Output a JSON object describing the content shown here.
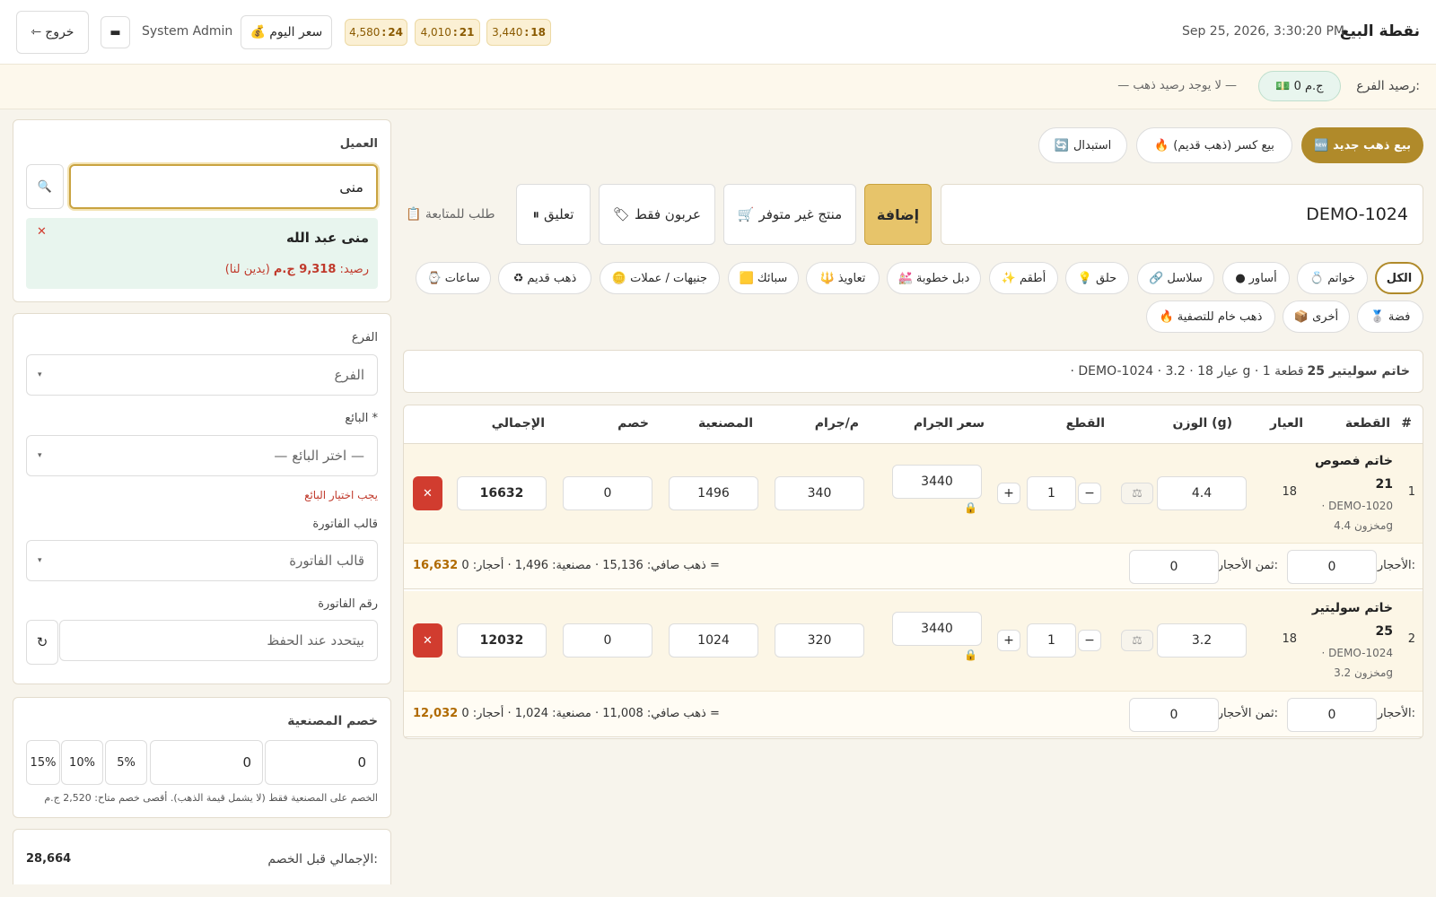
{
  "header": {
    "brand": "نقطة البيع",
    "datetime": "Sep 25, 2026, 3:30:20 PM",
    "logout_label": "خروج",
    "minimize_label": "▬",
    "user": "System Admin",
    "today_price_label": "سعر اليوم",
    "karats": [
      {
        "k": "18",
        "price": "3,440"
      },
      {
        "k": "21",
        "price": "4,010"
      },
      {
        "k": "24",
        "price": "4,580"
      }
    ]
  },
  "balance": {
    "label": "رصيد الفرع:",
    "value": "0 ج.م",
    "no_gold": "— لا يوجد رصيد ذهب —"
  },
  "modes": {
    "sell_new": "بيع ذهب جديد",
    "sell_scrap": "بيع كسر (ذهب قديم)",
    "exchange": "استبدال"
  },
  "entry": {
    "code": "DEMO-1024",
    "add_label": "إضافة",
    "unavailable_label": "منتج غير متوفر",
    "deposit_label": "عربون فقط",
    "hold_label": "تعليق",
    "followup_label": "طلب للمتابعة"
  },
  "categories": {
    "all": "الكل",
    "rings": "خواتم",
    "bracelets": "أساور",
    "chains": "سلاسل",
    "earrings": "حلق",
    "sets": "أطقم",
    "engagement": "دبل خطوبة",
    "amulets": "تعاويذ",
    "bars": "سبائك",
    "coins": "جنيهات / عملات",
    "old_gold": "ذهب قديم",
    "watches": "ساعات",
    "silver": "فضة",
    "other": "أخرى",
    "raw_gold": "ذهب خام للتصفية"
  },
  "info": {
    "name": "خاتم سوليتير 25",
    "details": "· DEMO-1024 · عيار 18 · 3.2 g · 1 قطعة"
  },
  "table": {
    "headers": {
      "num": "#",
      "item": "القطعة",
      "karat": "العيار",
      "weight": "الوزن (g)",
      "pieces": "القطع",
      "gram_price": "سعر الجرام",
      "per_gram": "م/جرام",
      "making": "المصنعية",
      "discount": "خصم",
      "total": "الإجمالي"
    },
    "rows": [
      {
        "num": "1",
        "name": "خاتم فصوص",
        "name2": "21",
        "code": "· DEMO-1020",
        "stock": "مخزون 4.4g",
        "karat": "18",
        "weight": "4.4",
        "pieces": "1",
        "gram_price": "3440",
        "per_gram": "340",
        "making": "1496",
        "discount": "0",
        "total": "16632",
        "stones_label": "الأحجار:",
        "stones": "0",
        "stones_price_label": "ثمن الأحجار:",
        "stones_price": "0",
        "summary": "ذهب صافي: 15,136 · مصنعية: 1,496 · أحجار: 0 =",
        "summary_total": "16,632"
      },
      {
        "num": "2",
        "name": "خاتم سوليتير",
        "name2": "25",
        "code": "· DEMO-1024",
        "stock": "مخزون 3.2g",
        "karat": "18",
        "weight": "3.2",
        "pieces": "1",
        "gram_price": "3440",
        "per_gram": "320",
        "making": "1024",
        "discount": "0",
        "total": "12032",
        "stones_label": "الأحجار:",
        "stones": "0",
        "stones_price_label": "ثمن الأحجار:",
        "stones_price": "0",
        "summary": "ذهب صافي: 11,008 · مصنعية: 1,024 · أحجار: 0 =",
        "summary_total": "12,032"
      }
    ]
  },
  "customer": {
    "label": "العميل",
    "query": "منى",
    "name": "منى عبد الله",
    "balance_label": "رصيد:",
    "balance_value": "9,318 ج.م",
    "balance_note": "(يدين لنا)"
  },
  "form": {
    "branch_label": "الفرع",
    "branch_placeholder": "الفرع",
    "seller_label": "البائع *",
    "seller_placeholder": "— اختر البائع —",
    "seller_error": "يجب اختيار البائع",
    "template_label": "قالب الفاتورة",
    "template_placeholder": "قالب الفاتورة",
    "invoice_label": "رقم الفاتورة",
    "invoice_placeholder": "بيتحدد عند الحفظ"
  },
  "discount": {
    "label": "خصم المصنعية",
    "value1": "0",
    "value2": "0",
    "p5": "5%",
    "p10": "10%",
    "p15": "15%",
    "note": "الخصم على المصنعية فقط (لا يشمل قيمة الذهب). أقصى خصم متاح: 2,520 ج.م"
  },
  "totals": {
    "before_label": "الإجمالي قبل الخصم:",
    "before_value": "28,664"
  },
  "colors": {
    "accent": "#b08a2a",
    "danger": "#d13c2f",
    "success_bg": "#e8f5ee"
  }
}
